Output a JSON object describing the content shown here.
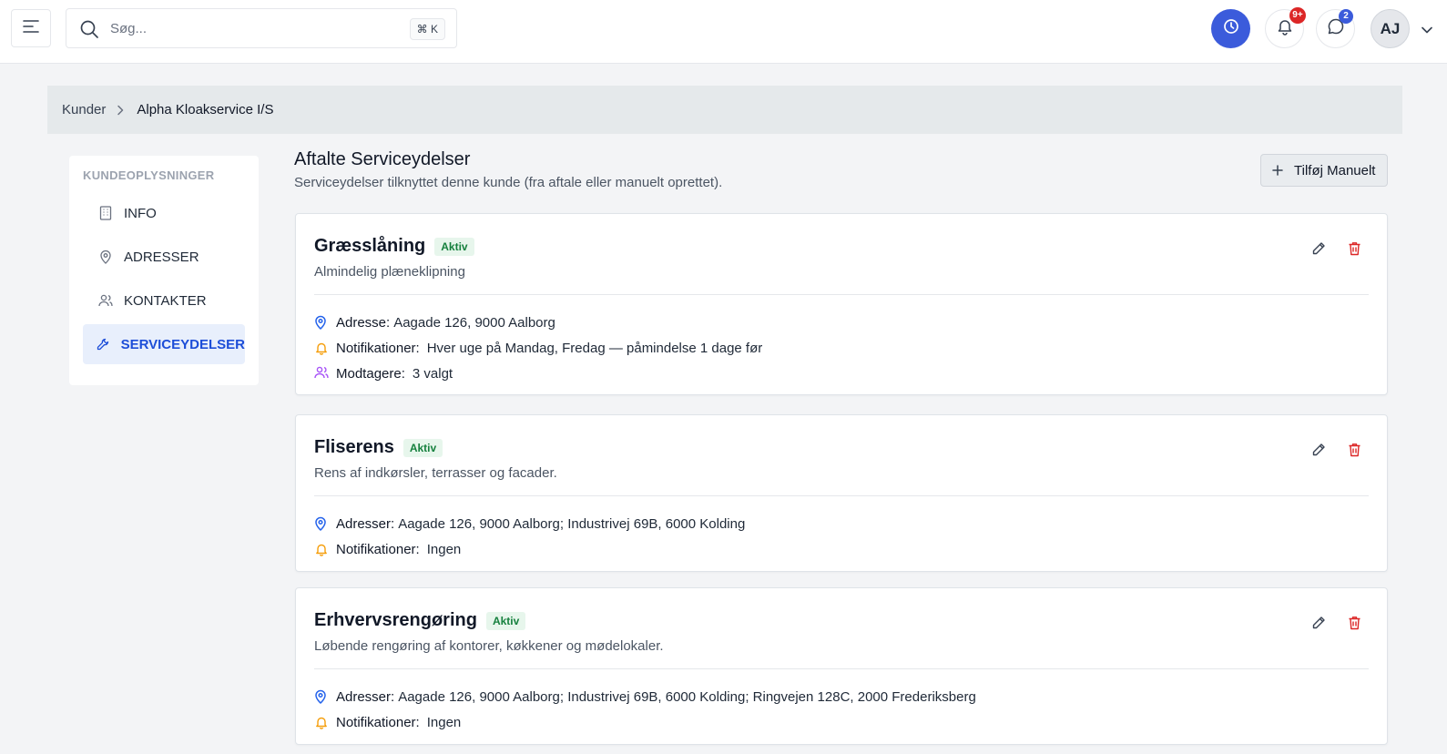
{
  "topbar": {
    "search_placeholder": "Søg...",
    "shortcut": "⌘ K",
    "notifications_badge": "9+",
    "messages_badge": "2",
    "avatar_initials": "AJ"
  },
  "breadcrumb": {
    "root": "Kunder",
    "current": "Alpha Kloakservice I/S"
  },
  "sidebar": {
    "heading": "KUNDEOPLYSNINGER",
    "items": [
      {
        "label": "INFO",
        "icon": "building-icon",
        "active": false
      },
      {
        "label": "ADRESSER",
        "icon": "map-pin-icon",
        "active": false
      },
      {
        "label": "KONTAKTER",
        "icon": "users-icon",
        "active": false
      },
      {
        "label": "SERVICEYDELSER",
        "icon": "wrench-icon",
        "active": true
      }
    ]
  },
  "main": {
    "title": "Aftalte Serviceydelser",
    "subtitle": "Serviceydelser tilknyttet denne kunde (fra aftale eller manuelt oprettet).",
    "add_button": "Tilføj Manuelt"
  },
  "services": [
    {
      "title": "Græsslåning",
      "status": "Aktiv",
      "description": "Almindelig plæneklipning",
      "address_label": "Adresse:",
      "address": "Aagade 126, 9000 Aalborg",
      "notifications_label": "Notifikationer:",
      "notifications": "Hver uge på Mandag, Fredag — påmindelse 1 dage før",
      "recipients_label": "Modtagere:",
      "recipients": "3 valgt"
    },
    {
      "title": "Fliserens",
      "status": "Aktiv",
      "description": "Rens af indkørsler, terrasser og facader.",
      "address_label": "Adresser:",
      "address": "Aagade 126, 9000 Aalborg; Industrivej 69B, 6000 Kolding",
      "notifications_label": "Notifikationer:",
      "notifications": "Ingen"
    },
    {
      "title": "Erhvervsrengøring",
      "status": "Aktiv",
      "description": "Løbende rengøring af kontorer, køkkener og mødelokaler.",
      "address_label": "Adresser:",
      "address": "Aagade 126, 9000 Aalborg; Industrivej 69B, 6000 Kolding; Ringvejen 128C, 2000 Frederiksberg",
      "notifications_label": "Notifikationer:",
      "notifications": "Ingen"
    }
  ],
  "colors": {
    "accent": "#3b5bdb",
    "active_bg": "#e8effc",
    "active_text": "#1d4ed8",
    "status_green": "#15803d",
    "delete_red": "#dc2626",
    "pin_blue": "#2563eb",
    "bell_amber": "#f59e0b",
    "users_purple": "#a855f7"
  }
}
